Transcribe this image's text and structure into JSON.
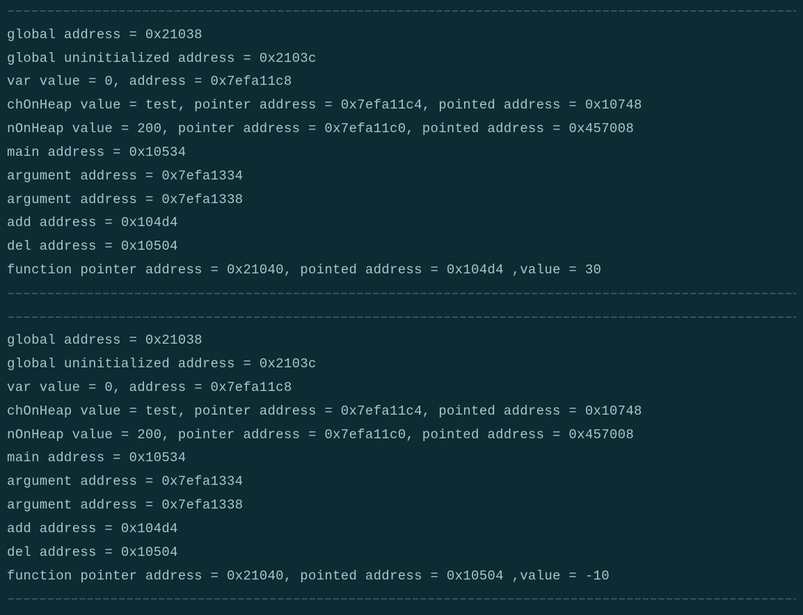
{
  "divider": "––––––––––––––––––––––––––––––––––––––––––––––––––––––––––––––––––––––––––––––––––––––––––––––––––––",
  "block1": {
    "lines": [
      "global address = 0x21038",
      "global uninitialized address = 0x2103c",
      "var value = 0, address = 0x7efa11c8",
      "chOnHeap value = test, pointer address = 0x7efa11c4, pointed address = 0x10748",
      "nOnHeap value = 200, pointer address = 0x7efa11c0, pointed address = 0x457008",
      "main address = 0x10534",
      "argument address = 0x7efa1334",
      "argument address = 0x7efa1338",
      "add address = 0x104d4",
      "del address = 0x10504",
      "function pointer address = 0x21040, pointed address = 0x104d4 ,value = 30"
    ]
  },
  "block2": {
    "lines": [
      "global address = 0x21038",
      "global uninitialized address = 0x2103c",
      "var value = 0, address = 0x7efa11c8",
      "chOnHeap value = test, pointer address = 0x7efa11c4, pointed address = 0x10748",
      "nOnHeap value = 200, pointer address = 0x7efa11c0, pointed address = 0x457008",
      "main address = 0x10534",
      "argument address = 0x7efa1334",
      "argument address = 0x7efa1338",
      "add address = 0x104d4",
      "del address = 0x10504",
      "function pointer address = 0x21040, pointed address = 0x10504 ,value = -10"
    ]
  }
}
